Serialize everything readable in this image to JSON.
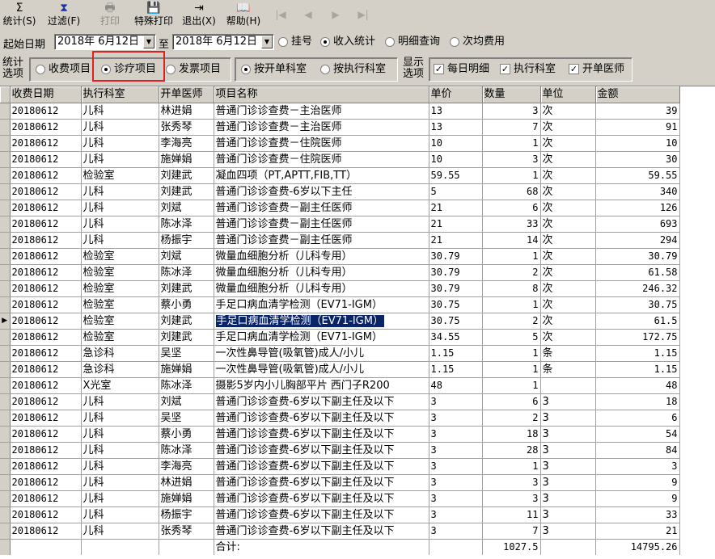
{
  "toolbar": {
    "buttons": [
      {
        "label": "统计(S)",
        "icon": "Σ",
        "disabled": false
      },
      {
        "label": "过滤(F)",
        "icon": "⧗",
        "disabled": false
      },
      {
        "label": "打印",
        "icon": "🖶",
        "disabled": true
      },
      {
        "label": "特殊打印",
        "icon": "💾",
        "disabled": false
      },
      {
        "label": "退出(X)",
        "icon": "⇥",
        "disabled": false
      },
      {
        "label": "帮助(H)",
        "icon": "📖",
        "disabled": false
      }
    ],
    "nav": [
      "|◀",
      "◀",
      "▶",
      "▶|"
    ]
  },
  "filter": {
    "start_label": "起始日期",
    "start_date": "2018年 6月12日",
    "to_label": "至",
    "end_date": "2018年 6月12日",
    "modes": [
      {
        "label": "挂号",
        "selected": false
      },
      {
        "label": "收入统计",
        "selected": true
      },
      {
        "label": "明细查询",
        "selected": false
      },
      {
        "label": "次均费用",
        "selected": false
      }
    ]
  },
  "options": {
    "stat_label_1": "统计",
    "stat_label_2": "选项",
    "stat_items": [
      {
        "label": "收费项目",
        "selected": false
      },
      {
        "label": "诊疗项目",
        "selected": true
      },
      {
        "label": "发票项目",
        "selected": false
      }
    ],
    "dept_items": [
      {
        "label": "按开单科室",
        "selected": true
      },
      {
        "label": "按执行科室",
        "selected": false
      }
    ],
    "display_label_1": "显示",
    "display_label_2": "选项",
    "display_items": [
      {
        "label": "每日明细",
        "checked": true
      },
      {
        "label": "执行科室",
        "checked": true
      },
      {
        "label": "开单医师",
        "checked": true
      }
    ]
  },
  "grid": {
    "columns": [
      "收费日期",
      "执行科室",
      "开单医师",
      "项目名称",
      "单价",
      "数量",
      "单位",
      "金额"
    ],
    "selected_row": 13,
    "rows": [
      [
        "20180612",
        "儿科",
        "林进娟",
        "普通门诊诊查费－主治医师",
        "13",
        "3",
        "次",
        "39"
      ],
      [
        "20180612",
        "儿科",
        "张秀琴",
        "普通门诊诊查费－主治医师",
        "13",
        "7",
        "次",
        "91"
      ],
      [
        "20180612",
        "儿科",
        "李海亮",
        "普通门诊诊查费－住院医师",
        "10",
        "1",
        "次",
        "10"
      ],
      [
        "20180612",
        "儿科",
        "施婵娟",
        "普通门诊诊查费－住院医师",
        "10",
        "3",
        "次",
        "30"
      ],
      [
        "20180612",
        "检验室",
        "刘建武",
        "凝血四项（PT,APTT,FIB,TT）",
        "59.55",
        "1",
        "次",
        "59.55"
      ],
      [
        "20180612",
        "儿科",
        "刘建武",
        "普通门诊诊查费-6岁以下主任",
        "5",
        "68",
        "次",
        "340"
      ],
      [
        "20180612",
        "儿科",
        "刘斌",
        "普通门诊诊查费－副主任医师",
        "21",
        "6",
        "次",
        "126"
      ],
      [
        "20180612",
        "儿科",
        "陈冰泽",
        "普通门诊诊查费－副主任医师",
        "21",
        "33",
        "次",
        "693"
      ],
      [
        "20180612",
        "儿科",
        "杨振宇",
        "普通门诊诊查费－副主任医师",
        "21",
        "14",
        "次",
        "294"
      ],
      [
        "20180612",
        "检验室",
        "刘斌",
        "微量血细胞分析（儿科专用）",
        "30.79",
        "1",
        "次",
        "30.79"
      ],
      [
        "20180612",
        "检验室",
        "陈冰泽",
        "微量血细胞分析（儿科专用）",
        "30.79",
        "2",
        "次",
        "61.58"
      ],
      [
        "20180612",
        "检验室",
        "刘建武",
        "微量血细胞分析（儿科专用）",
        "30.79",
        "8",
        "次",
        "246.32"
      ],
      [
        "20180612",
        "检验室",
        "蔡小勇",
        "手足口病血清学检测（EV71-IGM）",
        "30.75",
        "1",
        "次",
        "30.75"
      ],
      [
        "20180612",
        "检验室",
        "刘建武",
        "手足口病血清学检测（EV71-IGM）",
        "30.75",
        "2",
        "次",
        "61.5"
      ],
      [
        "20180612",
        "检验室",
        "刘建武",
        "手足口病血清学检测（EV71-IGM）",
        "34.55",
        "5",
        "次",
        "172.75"
      ],
      [
        "20180612",
        "急诊科",
        "吴坚",
        "一次性鼻导管(吸氧管)成人/小儿",
        "1.15",
        "1",
        "条",
        "1.15"
      ],
      [
        "20180612",
        "急诊科",
        "施婵娟",
        "一次性鼻导管(吸氧管)成人/小儿",
        "1.15",
        "1",
        "条",
        "1.15"
      ],
      [
        "20180612",
        "X光室",
        "陈冰泽",
        "摄影5岁内小儿胸部平片 西门子R200",
        "48",
        "1",
        "",
        "48"
      ],
      [
        "20180612",
        "儿科",
        "刘斌",
        "普通门诊诊查费-6岁以下副主任及以下",
        "3",
        "6",
        "3",
        "18"
      ],
      [
        "20180612",
        "儿科",
        "吴坚",
        "普通门诊诊查费-6岁以下副主任及以下",
        "3",
        "2",
        "3",
        "6"
      ],
      [
        "20180612",
        "儿科",
        "蔡小勇",
        "普通门诊诊查费-6岁以下副主任及以下",
        "3",
        "18",
        "3",
        "54"
      ],
      [
        "20180612",
        "儿科",
        "陈冰泽",
        "普通门诊诊查费-6岁以下副主任及以下",
        "3",
        "28",
        "3",
        "84"
      ],
      [
        "20180612",
        "儿科",
        "李海亮",
        "普通门诊诊查费-6岁以下副主任及以下",
        "3",
        "1",
        "3",
        "3"
      ],
      [
        "20180612",
        "儿科",
        "林进娟",
        "普通门诊诊查费-6岁以下副主任及以下",
        "3",
        "3",
        "3",
        "9"
      ],
      [
        "20180612",
        "儿科",
        "施婵娟",
        "普通门诊诊查费-6岁以下副主任及以下",
        "3",
        "3",
        "3",
        "9"
      ],
      [
        "20180612",
        "儿科",
        "杨振宇",
        "普通门诊诊查费-6岁以下副主任及以下",
        "3",
        "11",
        "3",
        "33"
      ],
      [
        "20180612",
        "儿科",
        "张秀琴",
        "普通门诊诊查费-6岁以下副主任及以下",
        "3",
        "7",
        "3",
        "21"
      ]
    ],
    "total": {
      "label": "合计:",
      "quantity": "1027.5",
      "amount": "14795.26"
    }
  },
  "colors": {
    "highlight": "#e02020",
    "selection": "#0a246a"
  }
}
